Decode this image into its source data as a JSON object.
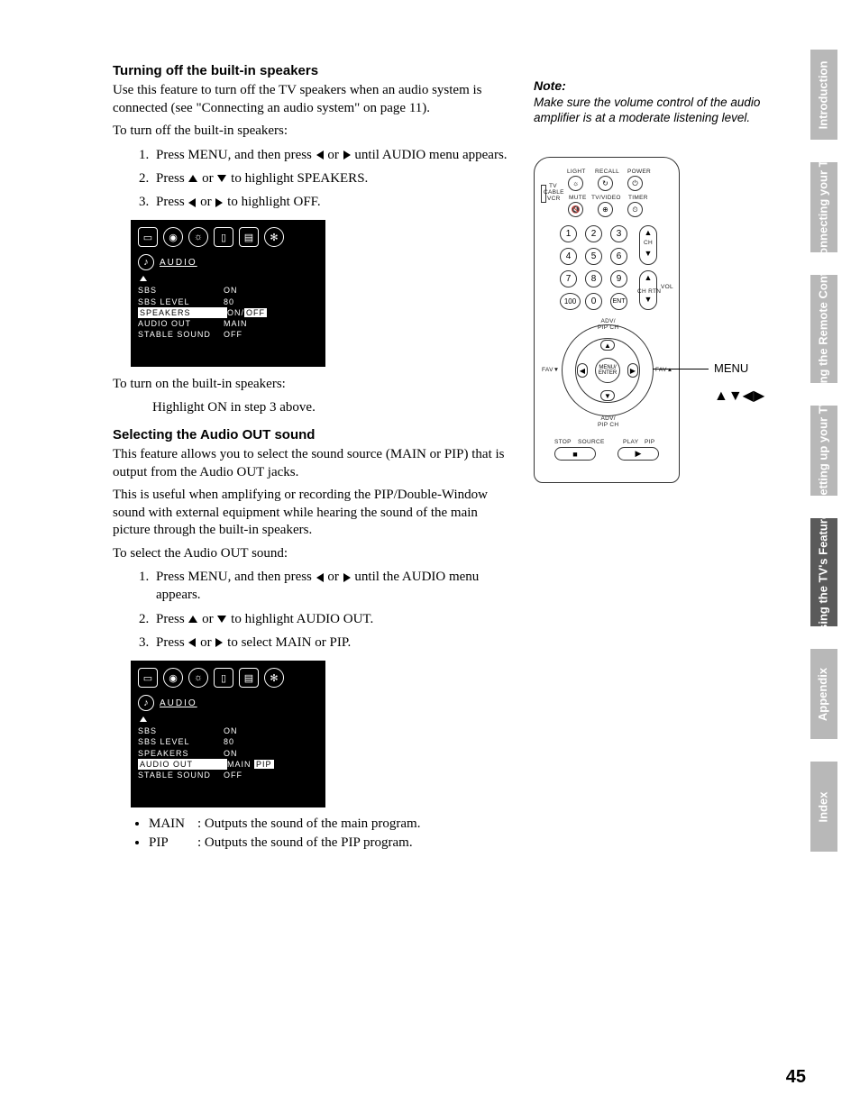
{
  "section1": {
    "heading": "Turning off the built-in speakers",
    "p1": "Use this feature to turn off the TV speakers when an audio system is connected (see \"Connecting an audio system\" on page 11).",
    "p2": "To turn off the built-in speakers:",
    "steps": {
      "s1a": "Press MENU, and then press ",
      "s1b": " or ",
      "s1c": " until AUDIO menu appears.",
      "s2a": "Press ",
      "s2b": " or ",
      "s2c": " to highlight SPEAKERS.",
      "s3a": "Press ",
      "s3b": " or ",
      "s3c": " to highlight OFF."
    },
    "p3": "To turn on the built-in speakers:",
    "p4": "Highlight ON in step 3 above."
  },
  "osd1": {
    "title": "AUDIO",
    "rows": [
      {
        "label": "SBS",
        "val": "ON"
      },
      {
        "label": "SBS  LEVEL",
        "val": "80"
      },
      {
        "label": "SPEAKERS",
        "val_a": "ON/",
        "val_b": "OFF",
        "hl_label": true,
        "hl_b": true
      },
      {
        "label": "AUDIO  OUT",
        "val": "MAIN"
      },
      {
        "label": "STABLE  SOUND",
        "val": "OFF"
      }
    ]
  },
  "section2": {
    "heading": "Selecting the Audio OUT sound",
    "p1": "This feature allows you to select the sound source (MAIN or PIP) that is output from the Audio OUT jacks.",
    "p2": "This is useful when amplifying or recording the PIP/Double-Window sound with external equipment while hearing the sound of the main picture through the built-in speakers.",
    "p3": "To select the Audio OUT sound:",
    "steps": {
      "s1a": "Press MENU, and then press ",
      "s1b": " or ",
      "s1c": " until the AUDIO menu appears.",
      "s2a": "Press ",
      "s2b": " or ",
      "s2c": " to highlight AUDIO OUT.",
      "s3a": "Press ",
      "s3b": " or ",
      "s3c": " to select MAIN or PIP."
    }
  },
  "osd2": {
    "title": "AUDIO",
    "rows": [
      {
        "label": "SBS",
        "val": "ON"
      },
      {
        "label": "SBS  LEVEL",
        "val": "80"
      },
      {
        "label": "SPEAKERS",
        "val": "ON"
      },
      {
        "label": "AUDIO  OUT",
        "val_a": "MAIN  ",
        "val_b": "PIP",
        "hl_label": true,
        "hl_b": true
      },
      {
        "label": "STABLE  SOUND",
        "val": "OFF"
      }
    ]
  },
  "defs": {
    "main_label": "MAIN",
    "main_desc": ":  Outputs the sound of the main program.",
    "pip_label": "PIP",
    "pip_desc": ":  Outputs the sound of the PIP program."
  },
  "note": {
    "head": "Note:",
    "body": "Make sure the volume control of the audio amplifier is at a moderate listening level."
  },
  "remote": {
    "labels": {
      "light": "LIGHT",
      "recall": "RECALL",
      "power": "POWER",
      "tv": "TV",
      "cable": "CABLE",
      "vcr": "VCR",
      "mute": "MUTE",
      "tvvideo": "TV/VIDEO",
      "timer": "TIMER",
      "ch": "CH",
      "chrtn": "CH RTN",
      "vol": "VOL",
      "ent": "ENT",
      "hundred": "100",
      "adv_t": "ADV/",
      "pipch_t": "PIP CH",
      "adv_b": "ADV/",
      "pipch_b": "PIP CH",
      "favl": "FAV▼",
      "favr": "FAV▲",
      "menu": "MENU/",
      "enter": "ENTER",
      "stop": "STOP",
      "source": "SOURCE",
      "play": "PLAY",
      "pip": "PIP"
    },
    "callouts": {
      "menu": "MENU",
      "arrows": "▲▼◀▶"
    }
  },
  "tabs": [
    {
      "label": "Introduction",
      "active": false
    },
    {
      "label": "Connecting\nyour TV",
      "active": false
    },
    {
      "label": "Using the\nRemote Control",
      "active": false
    },
    {
      "label": "Setting up\nyour TV",
      "active": false
    },
    {
      "label": "Using the TV's\nFeatures",
      "active": true
    },
    {
      "label": "Appendix",
      "active": false
    },
    {
      "label": "Index",
      "active": false
    }
  ],
  "page_number": "45"
}
